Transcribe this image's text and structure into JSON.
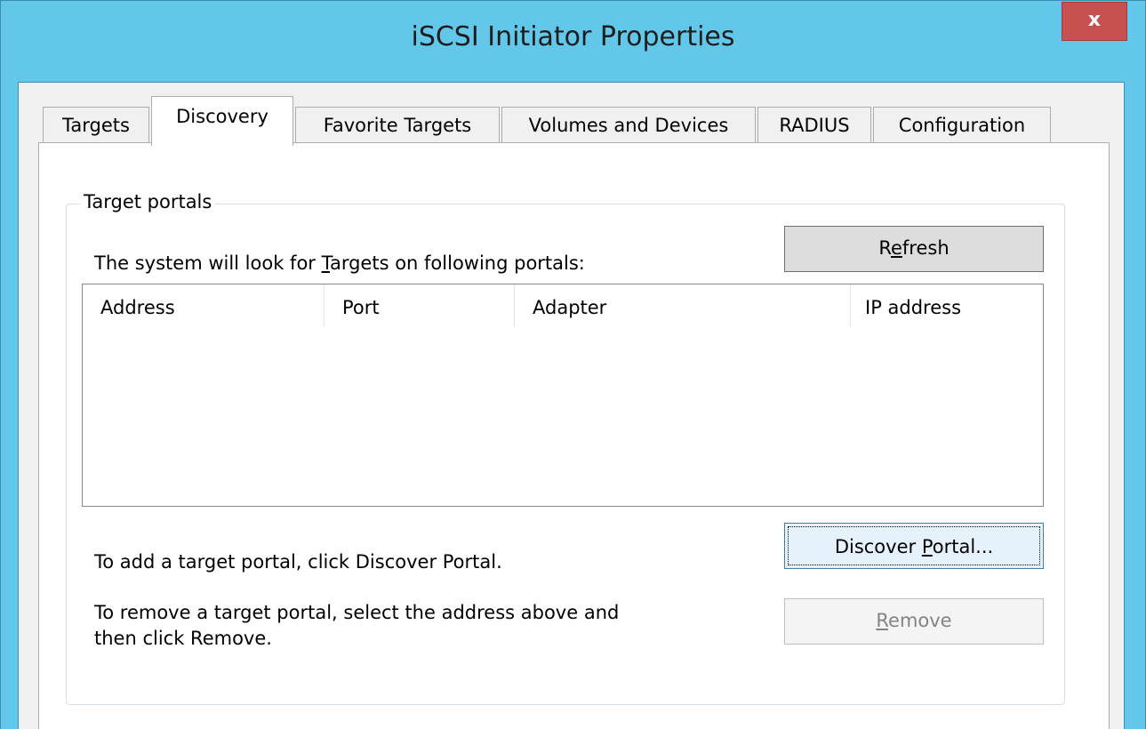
{
  "window": {
    "title": "iSCSI Initiator Properties",
    "close_label": "x"
  },
  "tabs": [
    {
      "label": "Targets",
      "active": false
    },
    {
      "label": "Discovery",
      "active": true
    },
    {
      "label": "Favorite Targets",
      "active": false
    },
    {
      "label": "Volumes and Devices",
      "active": false
    },
    {
      "label": "RADIUS",
      "active": false
    },
    {
      "label": "Configuration",
      "active": false
    }
  ],
  "target_portals": {
    "group_label": "Target portals",
    "intro": {
      "before": "The system will look for ",
      "mnemonic": "T",
      "after": "argets on following portals:"
    },
    "refresh": {
      "before": "R",
      "mnemonic": "e",
      "after": "fresh"
    },
    "columns": [
      "Address",
      "Port",
      "Adapter",
      "IP address"
    ],
    "rows": [],
    "add_hint": "To add a target portal, click Discover Portal.",
    "discover": {
      "before": "Discover ",
      "mnemonic": "P",
      "after": "ortal..."
    },
    "remove_hint_line1": "To remove a target portal, select the address above and",
    "remove_hint_line2": "then click Remove.",
    "remove": {
      "before": "",
      "mnemonic": "R",
      "after": "emove",
      "enabled": false
    }
  },
  "colors": {
    "frame": "#63c7ea",
    "close": "#c75050"
  }
}
